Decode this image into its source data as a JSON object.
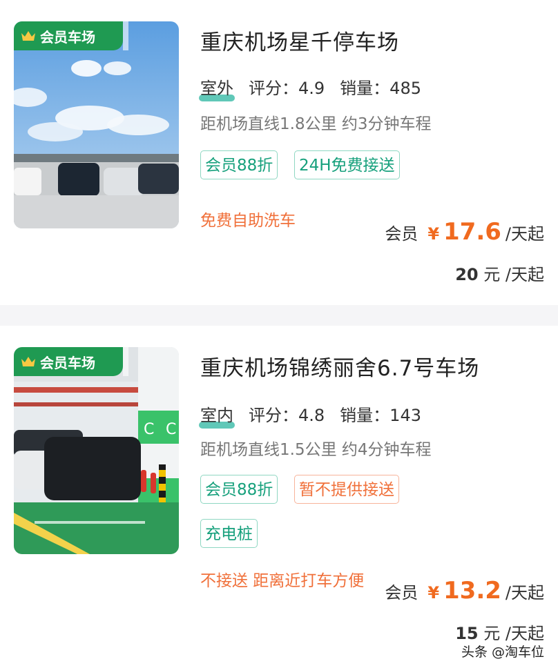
{
  "listings": [
    {
      "badge": "会员车场",
      "title": "重庆机场星千停车场",
      "type": "室外",
      "rating_label": "评分：",
      "rating": "4.9",
      "sales_label": "销量：",
      "sales": "485",
      "distance": "距机场直线1.8公里 约3分钟车程",
      "tags": [
        {
          "text": "会员88折",
          "style": "green"
        },
        {
          "text": "24H免费接送",
          "style": "green"
        }
      ],
      "promo": "免费自助洗车",
      "member_label": "会员",
      "currency": "¥",
      "member_price": "17.6",
      "unit": "/天起",
      "orig_price": "20",
      "orig_unit": "元 /天起"
    },
    {
      "badge": "会员车场",
      "title": "重庆机场锦绣丽舍6.7号车场",
      "type": "室内",
      "rating_label": "评分：",
      "rating": "4.8",
      "sales_label": "销量：",
      "sales": "143",
      "distance": "距机场直线1.5公里 约4分钟车程",
      "tags": [
        {
          "text": "会员88折",
          "style": "green"
        },
        {
          "text": "暂不提供接送",
          "style": "orange"
        },
        {
          "text": "充电桩",
          "style": "green"
        }
      ],
      "promo": "不接送 距离近打车方便",
      "member_label": "会员",
      "currency": "¥",
      "member_price": "13.2",
      "unit": "/天起",
      "orig_price": "15",
      "orig_unit": "元 /天起"
    }
  ],
  "watermark": "头条 @淘车位",
  "colors": {
    "badge": "#1f9a52",
    "price": "#f06a1f",
    "tag_green": "#16a07c",
    "tag_orange": "#f0703a"
  },
  "icons": {
    "badge_icon": "crown-icon"
  }
}
